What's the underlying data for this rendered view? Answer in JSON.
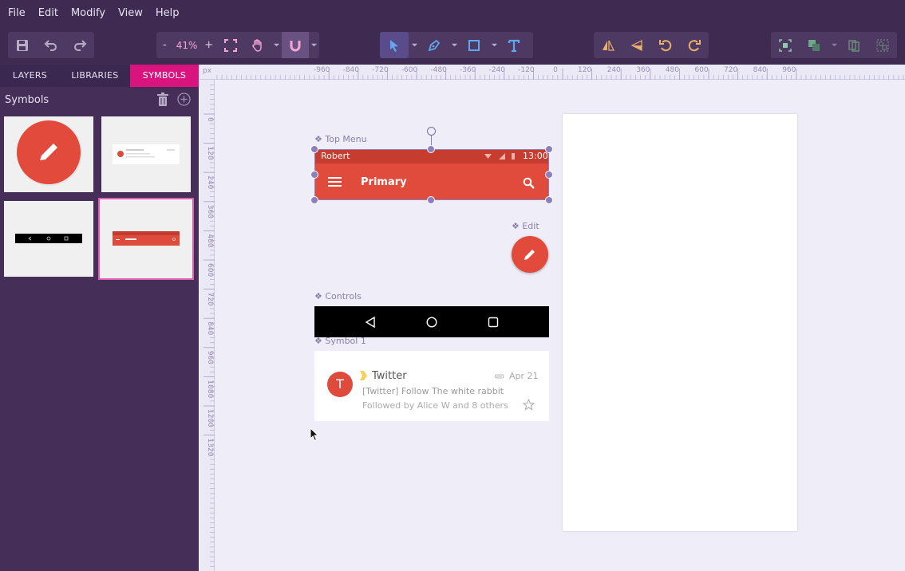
{
  "menu": [
    "File",
    "Edit",
    "Modify",
    "View",
    "Help"
  ],
  "toolbar": {
    "zoom_minus": "-",
    "zoom_value": "41%",
    "zoom_plus": "+"
  },
  "panel": {
    "tabs": [
      "LAYERS",
      "LIBRARIES",
      "SYMBOLS"
    ],
    "active_tab": "SYMBOLS",
    "title": "Symbols"
  },
  "ruler": {
    "unit": "px",
    "top_ticks": [
      "-960",
      "-840",
      "-720",
      "-600",
      "-480",
      "-360",
      "-240",
      "-120",
      "0",
      "120",
      "240",
      "360",
      "480",
      "600",
      "720",
      "840",
      "960"
    ],
    "left_ticks": [
      "0",
      "120",
      "240",
      "360",
      "480",
      "600",
      "720",
      "840",
      "960",
      "1080",
      "1200",
      "1320"
    ]
  },
  "canvas": {
    "top_menu_label": "Top Menu",
    "status_name": "Robert",
    "status_time": "13:00",
    "appbar_title": "Primary",
    "edit_label": "Edit",
    "controls_label": "Controls",
    "symbol1_label": "Symbol 1",
    "notification": {
      "avatar_letter": "T",
      "title": "Twitter",
      "date": "Apr 21",
      "line1": "[Twitter] Follow The white rabbit",
      "line2": "Followed by Alice W and 8 others"
    }
  },
  "colors": {
    "chrome": "#3f2b52",
    "accent": "#d9147f",
    "material_red": "#de4a3c",
    "selection": "#8c7fbf"
  }
}
